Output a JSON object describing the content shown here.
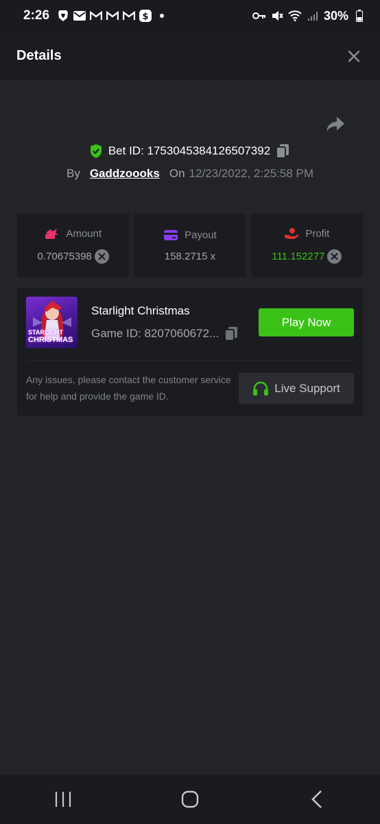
{
  "status_bar": {
    "time": "2:26",
    "battery": "30%",
    "left_icons": [
      "brave-lion-icon",
      "mail-icon",
      "gmail-icon",
      "gmail-icon",
      "gmail-icon",
      "cash-app-icon",
      "dot-icon"
    ],
    "right_icons": [
      "key-icon",
      "mute-icon",
      "wifi-icon",
      "signal-icon",
      "battery-icon"
    ]
  },
  "header": {
    "title": "Details",
    "close_icon": "close-icon"
  },
  "bet": {
    "bet_id_label": "Bet ID: 1753045384126507392",
    "by_label": "By",
    "username": "Gaddzoooks",
    "on_label": "On",
    "date": "12/23/2022, 2:25:58 PM"
  },
  "stats": [
    {
      "label": "Amount",
      "value": "0.70675398",
      "icon": "amount-icon",
      "icon_color": "#e9336d"
    },
    {
      "label": "Payout",
      "value": "158.2715 x",
      "icon": "card-icon",
      "icon_color": "#8b3bf3"
    },
    {
      "label": "Profit",
      "value": "111.152277",
      "icon": "profit-hand-icon",
      "icon_color": "#e03131"
    }
  ],
  "game": {
    "name": "Starlight Christmas",
    "game_id": "Game ID: 8207060672...",
    "play_label": "Play Now",
    "thumb_text_line1": "STARLIGHT",
    "thumb_text_line2": "CHRISTMAS"
  },
  "support": {
    "text": "Any issues, please contact the customer service for help and provide the game ID.",
    "button_label": "Live Support"
  },
  "colors": {
    "background": "#232428",
    "panel": "#1b1c1f",
    "accent_green": "#3bc117"
  }
}
